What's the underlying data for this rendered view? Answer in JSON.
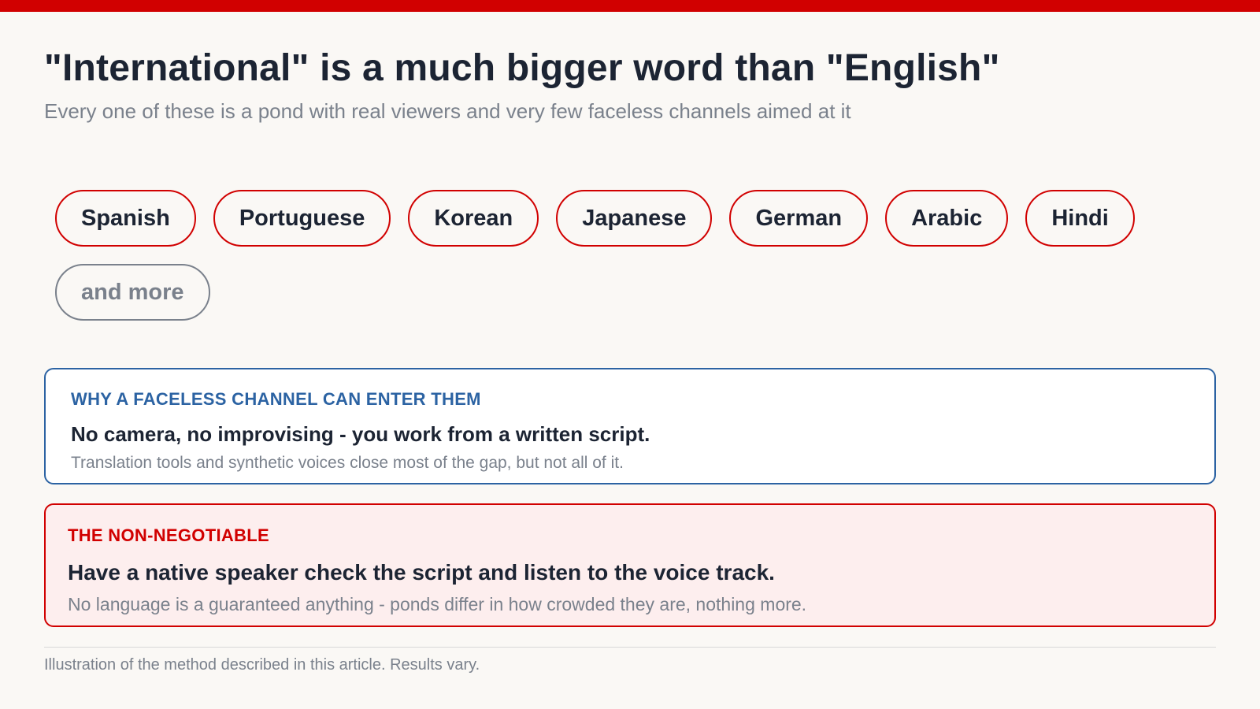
{
  "title": "\"International\" is a much bigger word than \"English\"",
  "subtitle": "Every one of these is a pond with real viewers and very few faceless channels aimed at it",
  "languages": [
    "Spanish",
    "Portuguese",
    "Korean",
    "Japanese",
    "German",
    "Arabic",
    "Hindi"
  ],
  "more_label": "and more",
  "why_card": {
    "eyebrow": "WHY A FACELESS CHANNEL CAN ENTER THEM",
    "headline": "No camera, no improvising - you work from a written script.",
    "note": "Translation tools and synthetic voices close most of the gap, but not all of it."
  },
  "rule_card": {
    "eyebrow": "THE NON-NEGOTIABLE",
    "headline": "Have a native speaker check the script and listen to the voice track.",
    "note": "No language is a guaranteed anything - ponds differ in how crowded they are, nothing more."
  },
  "footer": "Illustration of the method described in this article. Results vary.",
  "colors": {
    "accent_red": "#d10000",
    "accent_blue": "#2c63a3",
    "text_dark": "#1c2433",
    "text_muted": "#7a818c",
    "background": "#faf8f5",
    "red_card_bg": "#fdeeee"
  }
}
